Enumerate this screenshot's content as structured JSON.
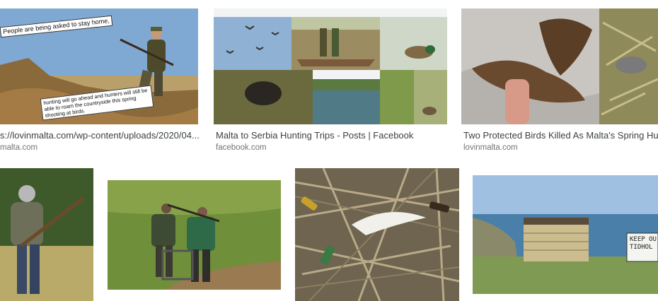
{
  "results": [
    {
      "caption": "s://lovinmalta.com/wp-content/uploads/2020/04...",
      "source": "malta.com",
      "overlay_top": "People are being asked to stay home,",
      "overlay_bottom": "hunting will go ahead and hunters will still be able to roam the countryside this spring shooting at birds."
    },
    {
      "caption": "Malta to Serbia Hunting Trips - Posts | Facebook",
      "source": "facebook.com"
    },
    {
      "caption": "Two Protected Birds Killed As Malta's Spring Hunti",
      "source": "lovinmalta.com"
    },
    {
      "caption": "",
      "source": ""
    },
    {
      "caption": "",
      "source": ""
    },
    {
      "caption": "",
      "source": ""
    },
    {
      "caption": "",
      "source": "",
      "sign_text": "KEEP OU TIDHOL"
    }
  ],
  "colors": {
    "caption": "#3c4043",
    "source": "#70757a",
    "sky": "#8fb3d6",
    "grass": "#6f8f3a"
  }
}
